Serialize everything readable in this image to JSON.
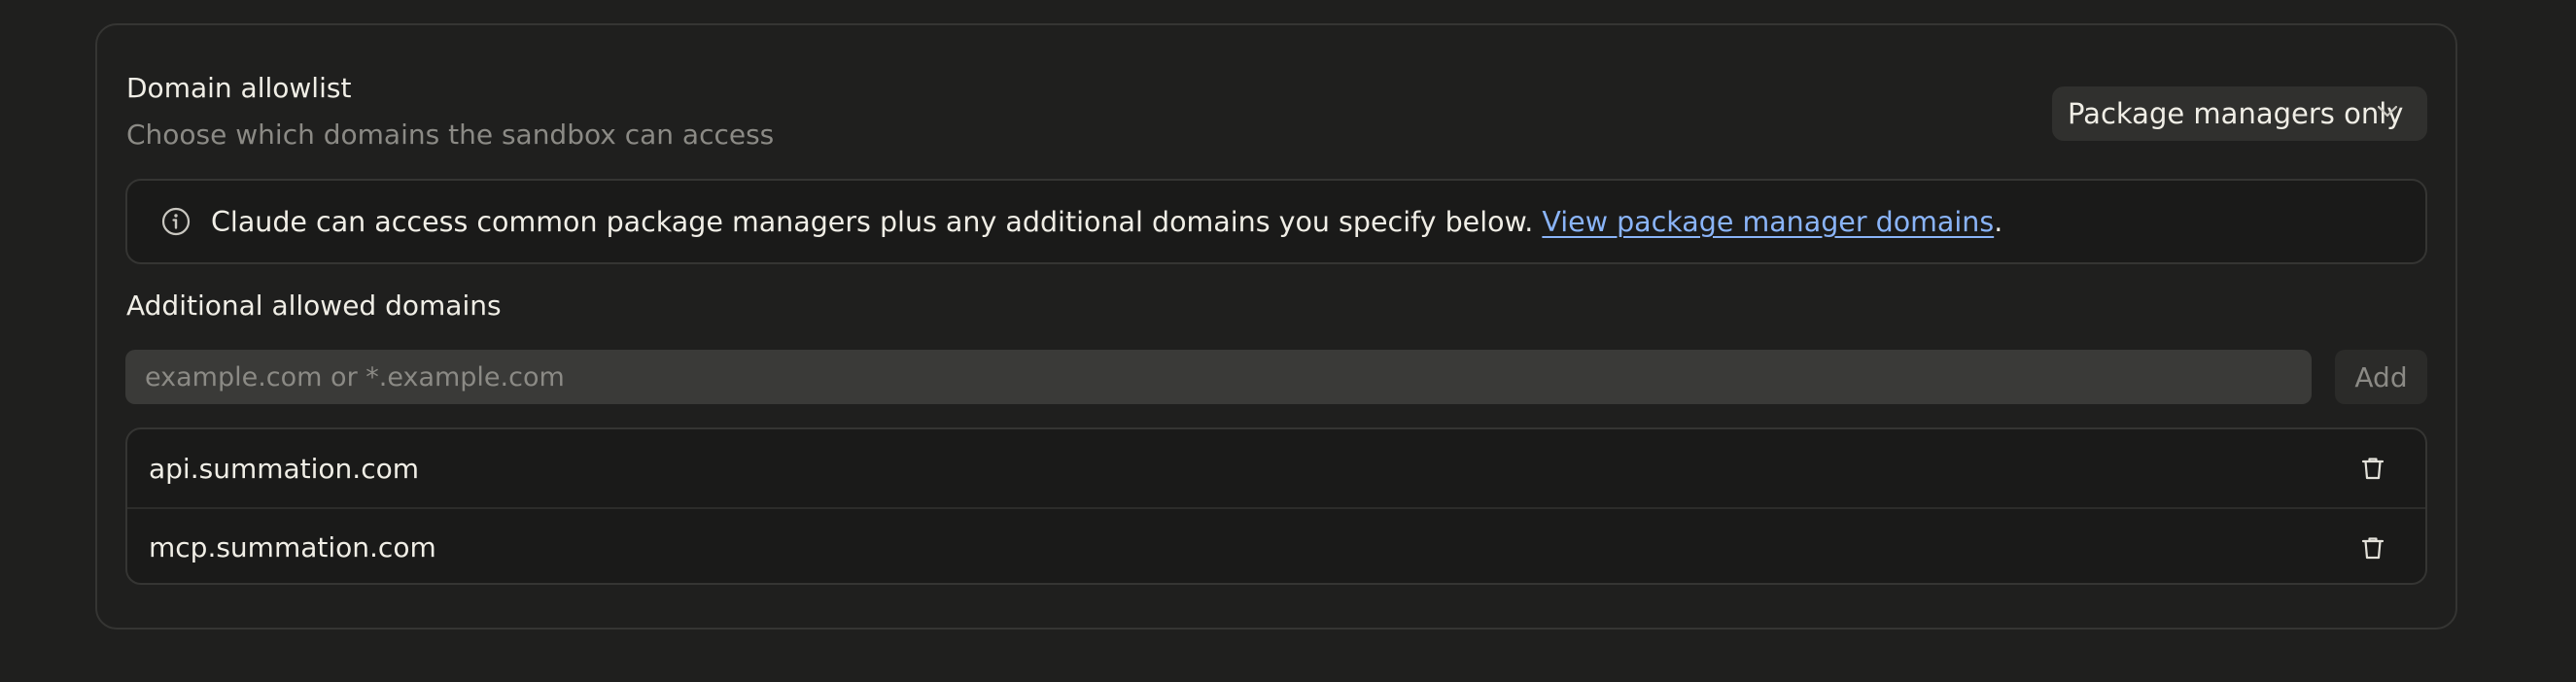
{
  "allowlist": {
    "title": "Domain allowlist",
    "subtitle": "Choose which domains the sandbox can access",
    "dropdown": {
      "selected": "Package managers only",
      "icon": "chevron-down-icon"
    }
  },
  "info": {
    "icon": "info-icon",
    "text": "Claude can access common package managers plus any additional domains you specify below. ",
    "link_label": "View package manager domains",
    "trailing": "."
  },
  "additional": {
    "heading": "Additional allowed domains",
    "input_placeholder": "example.com or *.example.com",
    "input_value": "",
    "add_label": "Add",
    "domains": [
      {
        "name": "api.summation.com",
        "delete_icon": "trash-icon"
      },
      {
        "name": "mcp.summation.com",
        "delete_icon": "trash-icon"
      }
    ]
  },
  "colors": {
    "background": "#1f1f1e",
    "card_border": "#353533",
    "text_primary": "#f0eee6",
    "text_secondary": "#8b8a85",
    "link": "#8ab4f8",
    "input_bg": "#3a3a38"
  }
}
